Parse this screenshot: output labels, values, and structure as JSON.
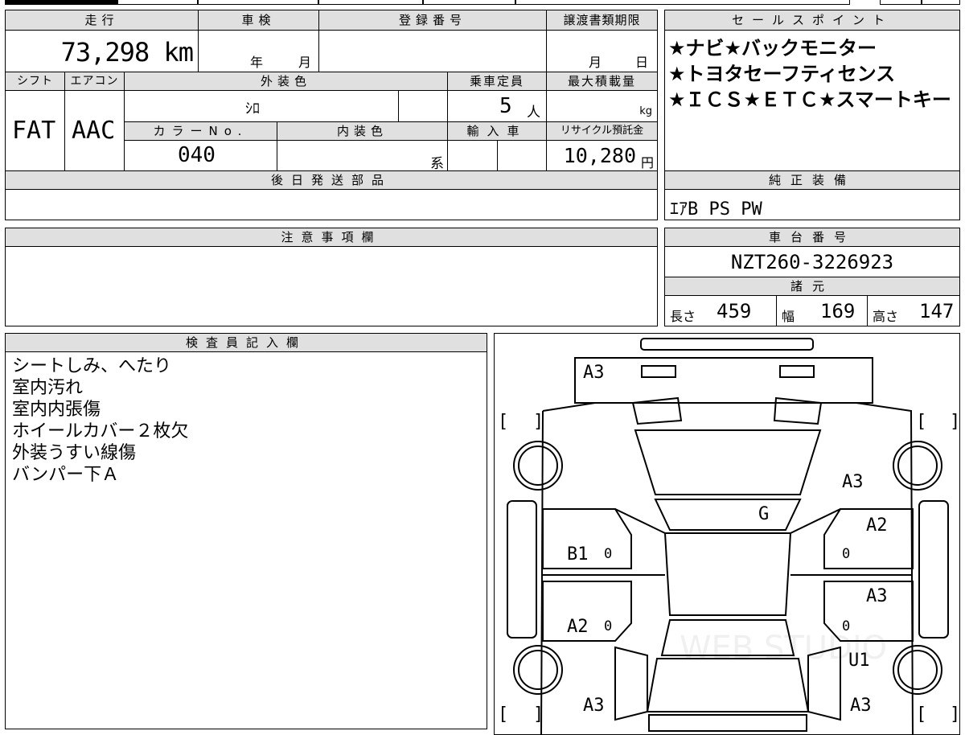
{
  "header": {
    "mileage_label": "走行",
    "shaken_label": "車検",
    "registration_label": "登録番号",
    "transfer_deadline_label": "譲渡書類期限",
    "sales_point_label": "セールスポイント"
  },
  "values": {
    "mileage": "73,298 km",
    "shaken_year_unit": "年",
    "shaken_month_unit": "月",
    "transfer_month_unit": "月",
    "transfer_day_unit": "日"
  },
  "labels": {
    "shift": "シフト",
    "aircon": "エアコン",
    "exterior_color": "外装色",
    "capacity": "乗車定員",
    "max_load": "最大積載量",
    "color_no": "カラーNo.",
    "interior_color": "内装色",
    "import": "輸入車",
    "recycle": "リサイクル預託金",
    "later_parts": "後日発送部品",
    "genuine_equipment": "純正装備",
    "cautions": "注意事項欄",
    "chassis_number": "車台番号",
    "specs": "諸元",
    "inspector": "検査員記入欄"
  },
  "vehicle": {
    "shift": "FAT",
    "aircon": "AAC",
    "exterior_color": "ｼﾛ",
    "capacity": "5",
    "capacity_unit": "人",
    "max_load_unit": "kg",
    "color_no": "040",
    "interior_color_suffix": "系",
    "recycle_fee": "10,280",
    "recycle_unit": "円",
    "genuine_equipment": "ｴｱB PS PW",
    "chassis_number": "NZT260-3226923",
    "length_label": "長さ",
    "length": "459",
    "width_label": "幅",
    "width": "169",
    "height_label": "高さ",
    "height": "147"
  },
  "sales_points": [
    "★ナビ★バックモニター",
    "★トヨタセーフティセンス",
    "★ＩＣＳ★ＥＴＣ★スマートキー"
  ],
  "inspector_notes": [
    "シートしみ、へたり",
    "室内汚れ",
    "室内内張傷",
    "ホイールカバー２枚欠",
    "外装うすい線傷",
    "バンパー下Ａ"
  ],
  "damage_marks": {
    "front_bumper": "A3",
    "right_front_fender": "A3",
    "bonnet_or_roof": "G",
    "right_front_door": "A2",
    "left_front_door": "B1",
    "right_rear_door": "A3",
    "left_rear_door": "A2",
    "right_rear_fender": "U1",
    "left_rear": "A3",
    "right_rear": "A3",
    "zero_l1": "0",
    "zero_l2": "0",
    "zero_r1": "0",
    "zero_r2": "0"
  },
  "watermark": "WEB STUDIO"
}
